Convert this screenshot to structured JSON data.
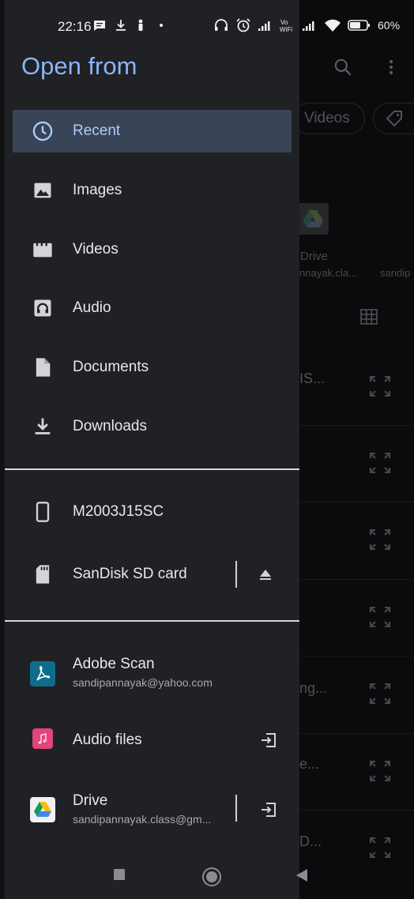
{
  "status_bar": {
    "time": "22:16",
    "battery": "60%"
  },
  "background": {
    "chip_videos": "Videos",
    "drive_label": "Drive",
    "drive_sub": "nnayak.cla...",
    "drive_sub2": "sandip",
    "rows": [
      "IS...",
      "ng...",
      "e...",
      "D..."
    ]
  },
  "drawer": {
    "title": "Open from",
    "items": [
      {
        "label": "Recent",
        "icon": "clock-icon",
        "active": true
      },
      {
        "label": "Images",
        "icon": "image-icon"
      },
      {
        "label": "Videos",
        "icon": "video-icon"
      },
      {
        "label": "Audio",
        "icon": "audio-icon"
      },
      {
        "label": "Documents",
        "icon": "document-icon"
      },
      {
        "label": "Downloads",
        "icon": "download-icon"
      }
    ],
    "storage": [
      {
        "label": "M2003J15SC",
        "icon": "phone-icon"
      },
      {
        "label": "SanDisk SD card",
        "icon": "sd-card-icon",
        "trailing": "eject-icon"
      }
    ],
    "apps": [
      {
        "label": "Adobe Scan",
        "sub": "sandipannayak@yahoo.com",
        "icon": "adobe-scan-icon",
        "color": "#0d6e8c"
      },
      {
        "label": "Audio files",
        "sub": "",
        "icon": "audio-files-icon",
        "color": "#e0457b",
        "trailing": "open-in-icon"
      },
      {
        "label": "Drive",
        "sub": "sandipannayak.class@gm...",
        "icon": "google-drive-icon",
        "trailing": "open-in-icon"
      }
    ]
  },
  "colors": {
    "accent": "#8ab4f8",
    "drawer_bg": "#202124",
    "active_bg": "#394457"
  }
}
